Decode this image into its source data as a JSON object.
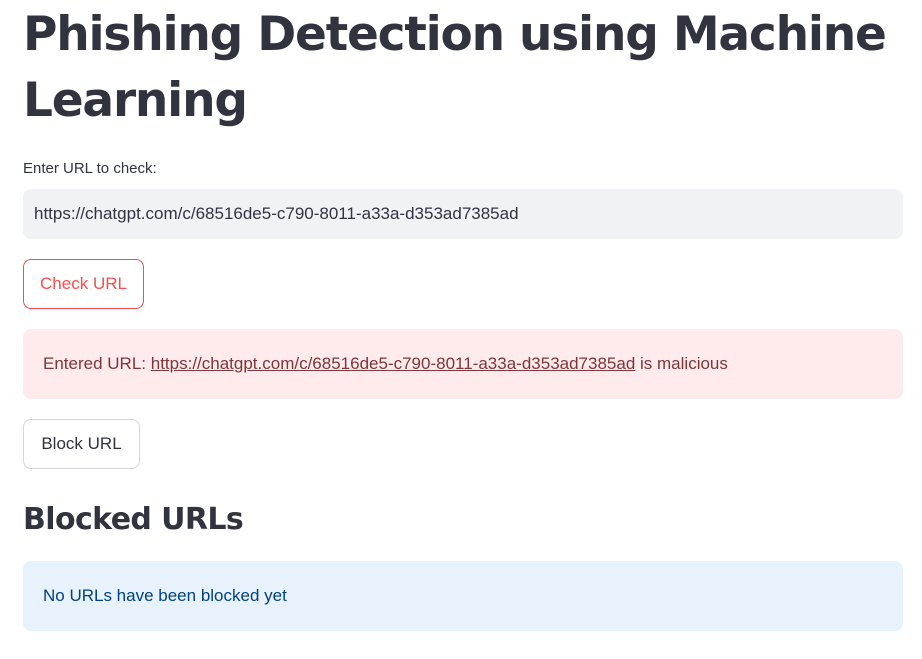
{
  "page": {
    "title": "Phishing Detection using Machine Learning"
  },
  "url_input": {
    "label": "Enter URL to check:",
    "value": "https://chatgpt.com/c/68516de5-c790-8011-a33a-d353ad7385ad"
  },
  "check_button": {
    "label": "Check URL"
  },
  "result_alert": {
    "prefix": "Entered URL: ",
    "url": "https://chatgpt.com/c/68516de5-c790-8011-a33a-d353ad7385ad",
    "suffix": " is malicious"
  },
  "block_button": {
    "label": "Block URL"
  },
  "blocked_section": {
    "heading": "Blocked URLs",
    "empty_message": "No URLs have been blocked yet"
  },
  "colors": {
    "primary": "#ff4b4b",
    "text": "#31333f",
    "error_bg": "#ffebeb",
    "error_text": "#7d353b",
    "info_bg": "#e8f2fc",
    "info_text": "#004280",
    "input_bg": "#f0f2f6"
  }
}
